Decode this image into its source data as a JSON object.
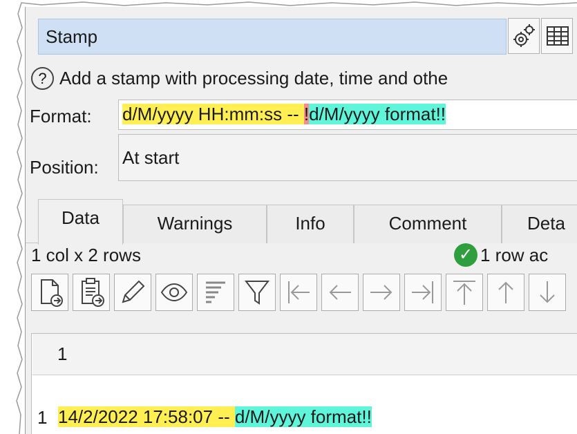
{
  "title": "Stamp",
  "icons": {
    "settings": "gears-icon",
    "table": "table-icon",
    "help": "question-circle-icon",
    "check": "check-circle-icon"
  },
  "help": {
    "symbol": "?",
    "text": "Add a stamp with processing date, time and othe"
  },
  "format": {
    "label": "Format:",
    "segments": [
      {
        "text": "d/M/yyyy HH:mm:ss -- ",
        "highlight": "yellow"
      },
      {
        "text": "!",
        "highlight": "red"
      },
      {
        "text": "d/M/yyyy format!!",
        "highlight": "cyan"
      }
    ]
  },
  "position": {
    "label": "Position:",
    "value": "At start"
  },
  "tabs": [
    {
      "label": "Data",
      "active": true
    },
    {
      "label": "Warnings"
    },
    {
      "label": "Info"
    },
    {
      "label": "Comment"
    },
    {
      "label": "Deta"
    }
  ],
  "status": {
    "dims": "1 col x 2 rows",
    "check_symbol": "✓",
    "rows_active": "1 row ac"
  },
  "toolbar": [
    "add-file-icon",
    "paste-icon",
    "edit-pencil-icon",
    "eye-icon",
    "sort-lines-icon",
    "filter-icon",
    "go-first-column-icon",
    "go-left-icon",
    "go-right-icon",
    "go-last-column-icon",
    "go-top-icon",
    "go-up-icon",
    "go-down-icon"
  ],
  "grid": {
    "column_header": "1",
    "row": {
      "number": "1",
      "segments": [
        {
          "text": "14/2/2022 17:58:07 -- ",
          "highlight": "yellow"
        },
        {
          "text": "d/M/yyyy format!!",
          "highlight": "cyan"
        }
      ]
    }
  },
  "colors": {
    "yellow": "#ffef52",
    "red": "#f48c8c",
    "cyan": "#5ff5da",
    "title_bg": "#cfe0f5",
    "check": "#2e9e3e"
  }
}
